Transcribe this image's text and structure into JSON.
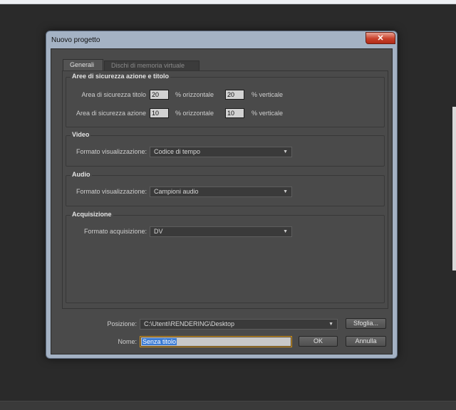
{
  "dialog": {
    "title": "Nuovo progetto",
    "close_glyph": "✕"
  },
  "tabs": [
    {
      "label": "Generali",
      "active": true
    },
    {
      "label": "Dischi di memoria virtuale",
      "active": false
    }
  ],
  "safe_areas": {
    "title": "Aree di sicurezza azione e titolo",
    "title_safe": {
      "label": "Area di sicurezza titolo",
      "horizontal": "20",
      "horizontal_unit": "% orizzontale",
      "vertical": "20",
      "vertical_unit": "% verticale"
    },
    "action_safe": {
      "label": "Area di sicurezza azione",
      "horizontal": "10",
      "horizontal_unit": "% orizzontale",
      "vertical": "10",
      "vertical_unit": "% verticale"
    }
  },
  "video": {
    "title": "Video",
    "format_label": "Formato visualizzazione:",
    "format_value": "Codice di tempo"
  },
  "audio": {
    "title": "Audio",
    "format_label": "Formato visualizzazione:",
    "format_value": "Campioni audio"
  },
  "capture": {
    "title": "Acquisizione",
    "format_label": "Formato acquisizione:",
    "format_value": "DV"
  },
  "location": {
    "label": "Posizione:",
    "value": "C:\\Utenti\\RENDERING\\Desktop",
    "browse_label": "Sfoglia..."
  },
  "name": {
    "label": "Nome:",
    "value": "Senza titolo"
  },
  "buttons": {
    "ok": "OK",
    "cancel": "Annulla"
  },
  "icons": {
    "dropdown": "chevron-down-icon",
    "close": "close-icon"
  },
  "colors": {
    "dialog_bg": "#4a4a4a",
    "title_frame": "#a4b2c4",
    "close_button": "#c8412c",
    "focus_border": "#c88d1c",
    "selection": "#3a7bd5"
  }
}
